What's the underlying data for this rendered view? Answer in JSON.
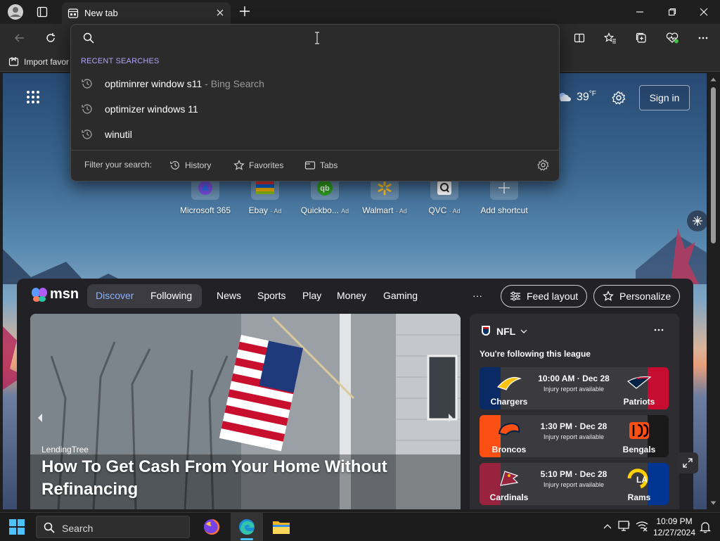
{
  "browser": {
    "tab_title": "New tab",
    "address_value": "",
    "favorites_bar_label": "Import favor"
  },
  "dropdown": {
    "recent_header": "RECENT SEARCHES",
    "suggestions": [
      {
        "text": "optiminrer window s11",
        "sub": "- Bing Search"
      },
      {
        "text": "optimizer windows 11",
        "sub": ""
      },
      {
        "text": "winutil",
        "sub": ""
      }
    ],
    "filter_label": "Filter your search:",
    "filters": [
      "History",
      "Favorites",
      "Tabs"
    ]
  },
  "page": {
    "weather_temp": "39",
    "weather_unit": "°F",
    "signin_label": "Sign in",
    "shortcuts": [
      {
        "label": "Microsoft 365",
        "ad": ""
      },
      {
        "label": "Ebay",
        "ad": "· Ad"
      },
      {
        "label": "Quickbo...",
        "ad": "Ad"
      },
      {
        "label": "Walmart",
        "ad": "· Ad"
      },
      {
        "label": "QVC",
        "ad": "· Ad"
      },
      {
        "label": "Add shortcut",
        "ad": ""
      }
    ]
  },
  "msn": {
    "logo_text": "msn",
    "nav": [
      "Discover",
      "Following",
      "News",
      "Sports",
      "Play",
      "Money",
      "Gaming"
    ],
    "more": "···",
    "feed_layout": "Feed layout",
    "personalize": "Personalize",
    "hero": {
      "source": "LendingTree",
      "headline": "How To Get Cash From Your Home Without Refinancing"
    },
    "nfl": {
      "title": "NFL",
      "following": "You're following this league",
      "games": [
        {
          "home": "Chargers",
          "away": "Patriots",
          "time": "10:00 AM · Dec 28",
          "note": "Injury report available",
          "home_color": "#0a2a66",
          "away_color": "#c60c30"
        },
        {
          "home": "Broncos",
          "away": "Bengals",
          "time": "1:30 PM · Dec 28",
          "note": "Injury report available",
          "home_color": "#fb4f14",
          "away_color": "#1a1a1a"
        },
        {
          "home": "Cardinals",
          "away": "Rams",
          "time": "5:10 PM · Dec 28",
          "note": "Injury report available",
          "home_color": "#97233f",
          "away_color": "#003594"
        }
      ]
    }
  },
  "taskbar": {
    "search_label": "Search",
    "time": "10:09 PM",
    "date": "12/27/2024"
  }
}
